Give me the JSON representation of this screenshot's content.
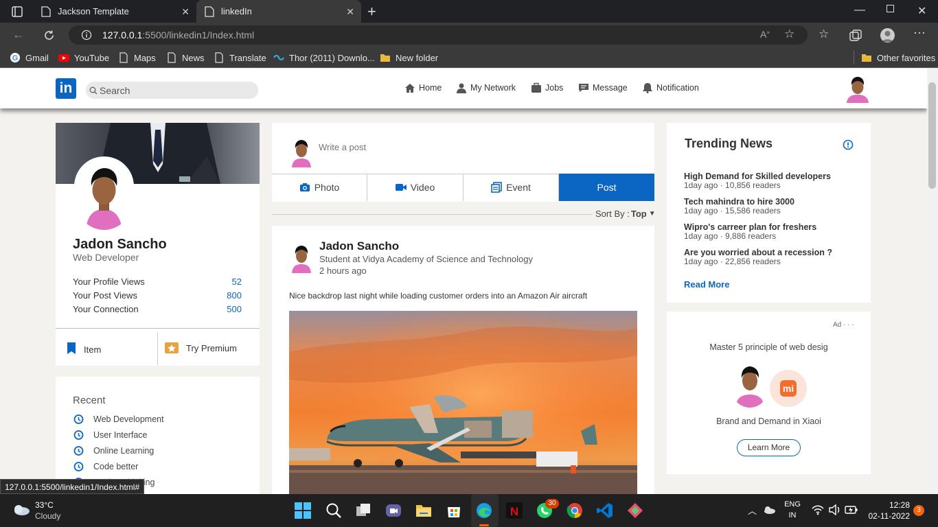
{
  "browser": {
    "tabs": [
      {
        "title": "Jackson Template",
        "active": false
      },
      {
        "title": "linkedIn",
        "active": true
      }
    ],
    "url_host": "127.0.0.1",
    "url_rest": ":5500/linkedin1/Index.html",
    "bookmarks": [
      "Gmail",
      "YouTube",
      "Maps",
      "News",
      "Translate",
      "Thor (2011) Downlo...",
      "New folder"
    ],
    "other_favorites": "Other favorites",
    "status_url": "127.0.0.1:5500/linkedin1/Index.html#"
  },
  "nav": {
    "logo": "in",
    "search_placeholder": "Search",
    "items": [
      "Home",
      "My Network",
      "Jobs",
      "Message",
      "Notification"
    ]
  },
  "profile": {
    "name": "Jadon Sancho",
    "title": "Web Developer",
    "stats": [
      {
        "label": "Your Profile Views",
        "value": "52"
      },
      {
        "label": "Your Post Views",
        "value": "800"
      },
      {
        "label": "Your Connection",
        "value": "500"
      }
    ],
    "item_label": "Item",
    "premium_label": "Try Premium"
  },
  "recent": {
    "heading": "Recent",
    "items": [
      "Web Development",
      "User Interface",
      "Online Learning",
      "Code better",
      "Design Thinking"
    ]
  },
  "composer": {
    "placeholder": "Write a post",
    "buttons": [
      "Photo",
      "Video",
      "Event",
      "Post"
    ],
    "sort_label": "Sort By :",
    "sort_value": "Top"
  },
  "post": {
    "author": "Jadon Sancho",
    "subtitle": "Student at Vidya Academy of Science and Technology",
    "time": "2 hours ago",
    "text": "Nice backdrop last night while loading customer orders into an Amazon Air aircraft"
  },
  "trending": {
    "heading": "Trending News",
    "items": [
      {
        "headline": "High Demand for Skilled developers",
        "meta": "1day ago · 10,856 readers"
      },
      {
        "headline": "Tech mahindra to hire 3000",
        "meta": "1day ago · 15,586 readers"
      },
      {
        "headline": "Wipro's carreer plan for freshers",
        "meta": "1day ago · 9,886 readers"
      },
      {
        "headline": "Are you worried about a recession ?",
        "meta": "1day ago · 22,856 readers"
      }
    ],
    "read_more": "Read More"
  },
  "ad": {
    "tag": "Ad · · ·",
    "headline": "Master 5 principle of web desig",
    "brand_line": "Brand and Demand in Xiaoi",
    "brand_logo": "mi",
    "button": "Learn More"
  },
  "taskbar": {
    "temp": "33°C",
    "weather": "Cloudy",
    "lang": "ENG",
    "region": "IN",
    "time": "12:28",
    "date": "02-11-2022",
    "whatsapp_badge": "30",
    "notif_badge": "3"
  },
  "colors": {
    "linkedin_blue": "#0a66c2",
    "post_button": "#0a66c2"
  }
}
